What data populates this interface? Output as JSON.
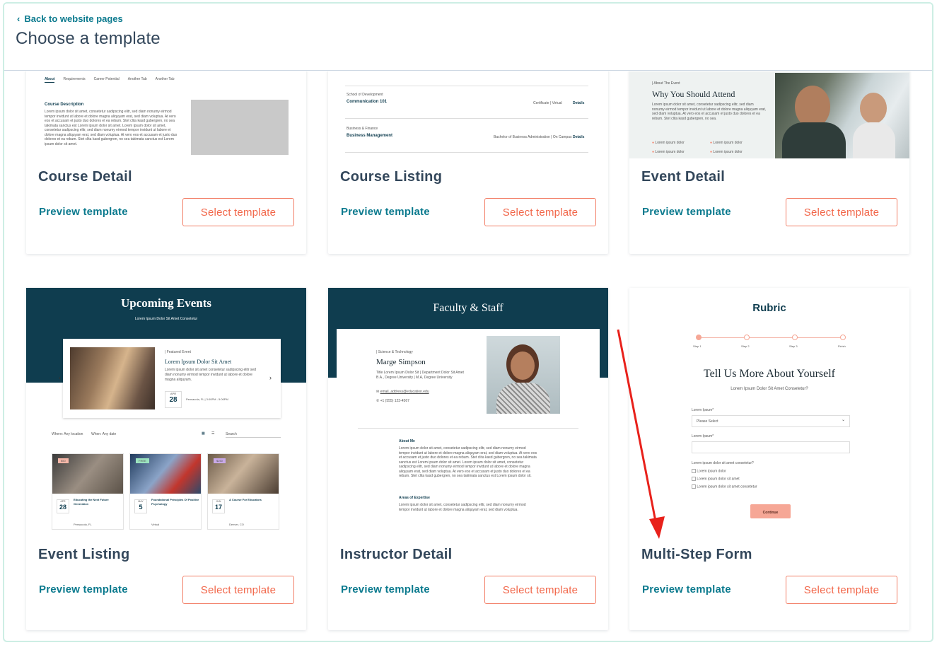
{
  "header": {
    "back_label": "Back to website pages",
    "title": "Choose a template"
  },
  "cards": [
    {
      "name": "Course Detail",
      "preview": "Preview template",
      "select": "Select template",
      "thumb": {
        "tabs": [
          "About",
          "Requirements",
          "Career Potential",
          "Another Tab",
          "Another Tab"
        ],
        "heading": "Course Description",
        "body": "Lorem ipsum dolor sit amet, consetetur sadipscing elitr, sed diam nonumy eirmod tempor invidunt ut labore et dolore magna aliquyam erat, sed diam voluptua. At vero eos et accusam et justo duo dolores et ea rebum. Stet clita kasd gubergren, no sea takimata sanctus est Lorem ipsum dolor sit amet. Lorem ipsum dolor sit amet, consetetur sadipscing elitr, sed diam nonumy eirmod tempor invidunt ut labore et dolore magna aliquyam erat, sed diam voluptua. At vero eos et accusam et justo duo dolores et ea rebum. Stet clita kasd gubergren, no sea takimata sanctus est Lorem ipsum dolor sit amet."
      }
    },
    {
      "name": "Course Listing",
      "preview": "Preview template",
      "select": "Select template",
      "thumb": {
        "rows": [
          {
            "category": "School of Development",
            "title": "Communication 101",
            "meta": "Certificate | Virtual",
            "details": "Details"
          },
          {
            "category": "Business & Finance",
            "title": "Business Management",
            "meta": "Bachelor of Business Administration | On Campus",
            "details": "Details"
          }
        ]
      }
    },
    {
      "name": "Event Detail",
      "preview": "Preview template",
      "select": "Select template",
      "thumb": {
        "eyebrow": "| About The Event",
        "heading": "Why You Should Attend",
        "body": "Lorem ipsum dolor sit amet, consetetur sadipscing elitr, sed diam nonumy eirmod tempor invidunt ut labore et dolore magna aliquyam erat, sed diam voluptua. At vero eos et accusam et justo duo dolores et ea rebum. Stet clita kasd gubergren, no sea.",
        "bullets": [
          "Lorem ipsum dolor",
          "Lorem ipsum dolor",
          "Lorem ipsum dolor",
          "Lorem ipsum dolor"
        ]
      }
    },
    {
      "name": "Event Listing",
      "preview": "Preview template",
      "select": "Select template",
      "thumb": {
        "heading": "Upcoming Events",
        "sub": "Lorem Ipsum Dolor Sit Amet Consetetur",
        "featured_label": "| Featured Event",
        "featured_title": "Lorem Ipsum Dolor Sit Amet",
        "featured_body": "Lorem ipsum dolor sit amet consetetur sadipscing elitr sed diam nonumy eirmod tempor invidunt ut labore et dolore magna aliquyam.",
        "featured_month": "APR",
        "featured_day": "28",
        "featured_loc": "Pensacola, FL | 3:00PM - 5:00PM",
        "filter_where": "Where: Any location",
        "filter_when": "When: Any date",
        "search": "Search",
        "events": [
          {
            "tag": "$50",
            "month": "APR",
            "day": "28",
            "title": "Educating the Next Future Generation",
            "loc": "Pensacola, FL"
          },
          {
            "tag": "FREE",
            "month": "MAY",
            "day": "5",
            "title": "Foundational Principles Of Positive Psychology",
            "loc": "Virtual"
          },
          {
            "tag": "$250",
            "month": "JUN",
            "day": "17",
            "title": "A Course For Educators",
            "loc": "Denver, CO"
          }
        ]
      }
    },
    {
      "name": "Instructor Detail",
      "preview": "Preview template",
      "select": "Select template",
      "thumb": {
        "heading": "Faculty & Staff",
        "eyebrow": "| Science & Technology",
        "person": "Marge Simpson",
        "role": "Title Lorem Ipsum Dolor Sit | Department Dolor Sit Amet",
        "degrees": "B.A., Degree University | M.A, Degree University",
        "email": "email_address@education.edu",
        "phone": "+1 (555) 123-4567",
        "about_h": "About Me",
        "about_body": "Lorem ipsum dolor sit amet, consetetur sadipscing elitr, sed diam nonumy eirmod tempor invidunt ut labore et dolore magna aliquyam erat, sed diam voluptua. At vero eos et accusam et justo duo dolores et ea rebum. Stet clita kasd gubergren, no sea takimata sanctus est Lorem ipsum dolor sit amet. Lorem ipsum dolor sit amet, consetetur sadipscing elitr, sed diam nonumy eirmod tempor invidunt ut labore et dolore magna aliquyam erat, sed diam voluptua. At vero eos et accusam et justo duo dolores et ea rebum. Stet clita kasd gubergren, no sea takimata sanctus est Lorem ipsum dolor sit.",
        "areas_h": "Areas of Expertise",
        "areas_body": "Lorem ipsum dolor sit amet, consetetur sadipscing elitr, sed diam nonumy eirmod tempor invidunt ut labore et dolore magna aliquyam erat, sed diam voluptua."
      }
    },
    {
      "name": "Multi-Step Form",
      "preview": "Preview template",
      "select": "Select template",
      "thumb": {
        "logo": "Rubric",
        "steps": [
          "Step 1",
          "Step 2",
          "Step 3",
          "Finish"
        ],
        "heading": "Tell Us More About Yourself",
        "sub": "Lorem Ipsum Dolor Sit Amet Consetetur?",
        "field1_label": "Lorem Ipsum*",
        "field1_value": "Please Select",
        "field2_label": "Lorem Ipsum*",
        "checkbox_q": "Lorem ipsum dolor sit amet consetetur?",
        "checkboxes": [
          "Lorem ipsum dolor",
          "Lorem ipsum dolor sit amet",
          "Lorem ipsum dolor sit amet consetetur"
        ],
        "continue": "Continue"
      }
    }
  ],
  "colors": {
    "teal": "#0b7a8e",
    "coral": "#f2674a",
    "navy": "#0f3d4f",
    "annotation_arrow": "#e8211b"
  }
}
